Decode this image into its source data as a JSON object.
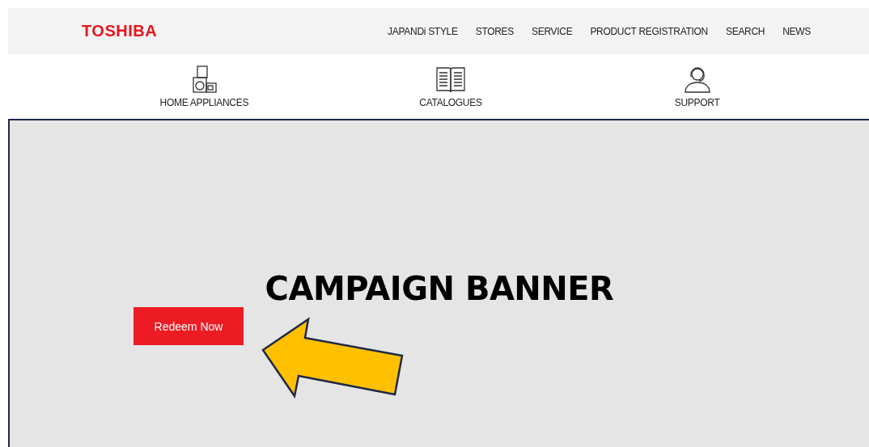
{
  "header": {
    "logo": "TOSHIBA",
    "nav": [
      "JAPANDi STYLE",
      "STORES",
      "SERVICE",
      "PRODUCT REGISTRATION",
      "SEARCH",
      "NEWS"
    ]
  },
  "categories": [
    {
      "kind": "appliances",
      "label": "HOME APPLIANCES"
    },
    {
      "kind": "catalogues",
      "label": "CATALOGUES"
    },
    {
      "kind": "support",
      "label": "SUPPORT"
    }
  ],
  "banner": {
    "title": "CAMPAIGN BANNER",
    "button": "Redeem Now"
  }
}
